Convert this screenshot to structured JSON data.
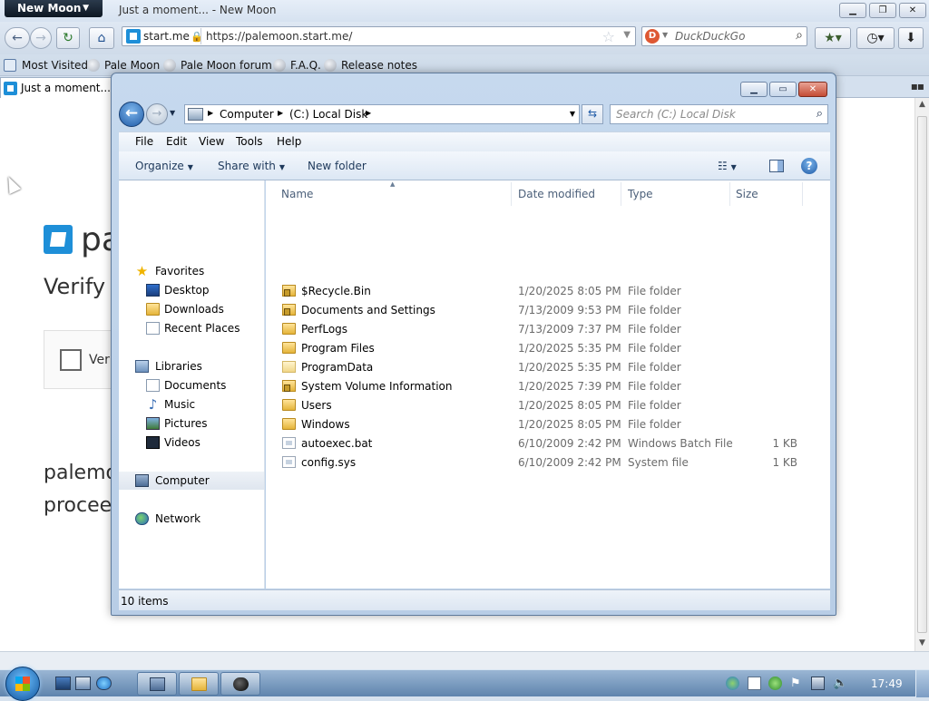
{
  "browser": {
    "app_menu_label": "New Moon",
    "window_title": "Just a moment... - New Moon",
    "identity_label": "start.me",
    "url": "https://palemoon.start.me/",
    "search_engine": "DuckDuckGo",
    "bookmarks": [
      "Most Visited",
      "Pale Moon",
      "Pale Moon forum",
      "F.A.Q.",
      "Release notes"
    ],
    "tab_title": "Just a moment...",
    "accent_color": "#1e8fd8"
  },
  "page": {
    "site_partial": "pa",
    "heading_partial": "Verify y",
    "checkbox_label_partial": "Verif",
    "note_line1": "palemo",
    "note_line2": "procee"
  },
  "explorer": {
    "breadcrumbs": [
      "Computer",
      "(C:) Local Disk"
    ],
    "search_placeholder": "Search (C:) Local Disk",
    "menu": [
      "File",
      "Edit",
      "View",
      "Tools",
      "Help"
    ],
    "commands": {
      "organize": "Organize",
      "share_with": "Share with",
      "new_folder": "New folder"
    },
    "nav": {
      "favorites": "Favorites",
      "favorites_items": [
        "Desktop",
        "Downloads",
        "Recent Places"
      ],
      "libraries": "Libraries",
      "libraries_items": [
        "Documents",
        "Music",
        "Pictures",
        "Videos"
      ],
      "computer": "Computer",
      "network": "Network"
    },
    "columns": {
      "name": "Name",
      "date": "Date modified",
      "type": "Type",
      "size": "Size"
    },
    "files": [
      {
        "name": "$Recycle.Bin",
        "date": "1/20/2025 8:05 PM",
        "type": "File folder",
        "size": "",
        "icon": "locked-folder-icon"
      },
      {
        "name": "Documents and Settings",
        "date": "7/13/2009 9:53 PM",
        "type": "File folder",
        "size": "",
        "icon": "locked-folder-icon"
      },
      {
        "name": "PerfLogs",
        "date": "7/13/2009 7:37 PM",
        "type": "File folder",
        "size": "",
        "icon": "folder-icon"
      },
      {
        "name": "Program Files",
        "date": "1/20/2025 5:35 PM",
        "type": "File folder",
        "size": "",
        "icon": "folder-icon"
      },
      {
        "name": "ProgramData",
        "date": "1/20/2025 5:35 PM",
        "type": "File folder",
        "size": "",
        "icon": "hidden-folder-icon"
      },
      {
        "name": "System Volume Information",
        "date": "1/20/2025 7:39 PM",
        "type": "File folder",
        "size": "",
        "icon": "locked-folder-icon"
      },
      {
        "name": "Users",
        "date": "1/20/2025 8:05 PM",
        "type": "File folder",
        "size": "",
        "icon": "folder-icon"
      },
      {
        "name": "Windows",
        "date": "1/20/2025 8:05 PM",
        "type": "File folder",
        "size": "",
        "icon": "folder-icon"
      },
      {
        "name": "autoexec.bat",
        "date": "6/10/2009 2:42 PM",
        "type": "Windows Batch File",
        "size": "1 KB",
        "icon": "batch-file-icon"
      },
      {
        "name": "config.sys",
        "date": "6/10/2009 2:42 PM",
        "type": "System file",
        "size": "1 KB",
        "icon": "system-file-icon"
      }
    ],
    "status": "10 items"
  },
  "taskbar": {
    "clock": "17:49"
  }
}
